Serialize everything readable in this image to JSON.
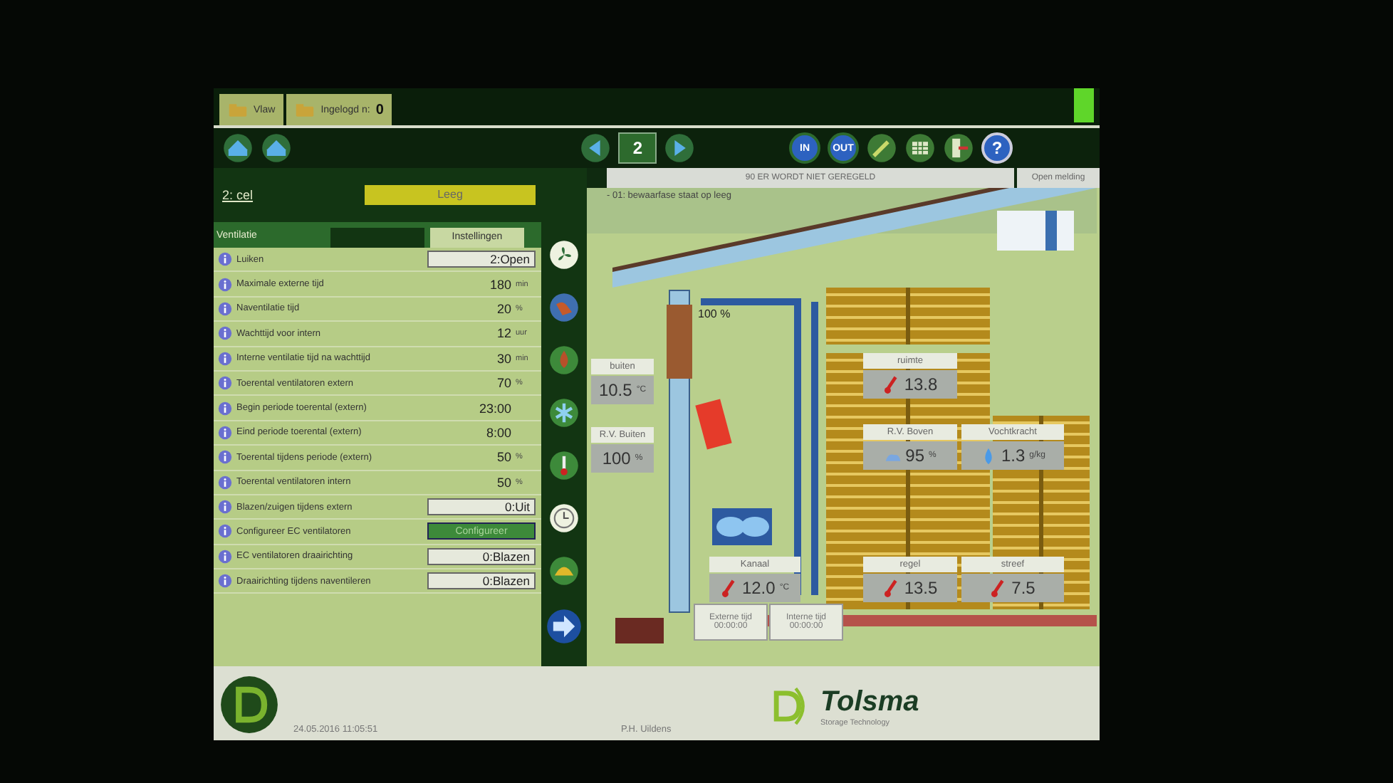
{
  "top_tabs": [
    {
      "label": "Vlaw"
    },
    {
      "label": "Ingelogd n:",
      "count": "0"
    }
  ],
  "nav": {
    "page": "2"
  },
  "toolbar": [
    {
      "kind": "in",
      "label": "IN"
    },
    {
      "kind": "out",
      "label": "OUT"
    },
    {
      "kind": "pencil"
    },
    {
      "kind": "grid"
    },
    {
      "kind": "exit"
    },
    {
      "kind": "help",
      "label": "?"
    }
  ],
  "cell": {
    "title": "2: cel",
    "phase": "Leeg"
  },
  "section": "Ventilatie",
  "tabs": [
    {
      "selected": false
    },
    {
      "label": "Instellingen",
      "selected": true
    }
  ],
  "rows": [
    {
      "kind": "field",
      "label": "Luiken",
      "value": "2:Open"
    },
    {
      "kind": "value",
      "label": "Maximale externe tijd",
      "value": "180",
      "unit": "min"
    },
    {
      "kind": "value",
      "label": "Naventilatie tijd",
      "value": "20",
      "unit": "%"
    },
    {
      "kind": "value",
      "label": "Wachttijd voor intern",
      "value": "12",
      "unit": "uur"
    },
    {
      "kind": "value",
      "label": "Interne ventilatie tijd na wachttijd",
      "value": "30",
      "unit": "min"
    },
    {
      "kind": "value",
      "label": "Toerental ventilatoren extern",
      "value": "70",
      "unit": "%"
    },
    {
      "kind": "value",
      "label": "Begin periode toerental (extern)",
      "value": "23:00"
    },
    {
      "kind": "value",
      "label": "Eind periode toerental (extern)",
      "value": "8:00"
    },
    {
      "kind": "value",
      "label": "Toerental tijdens periode (extern)",
      "value": "50",
      "unit": "%"
    },
    {
      "kind": "value",
      "label": "Toerental ventilatoren intern",
      "value": "50",
      "unit": "%"
    },
    {
      "kind": "field",
      "label": "Blazen/zuigen tijdens extern",
      "value": "0:Uit"
    },
    {
      "kind": "button",
      "label": "Configureer EC ventilatoren",
      "value": "Configureer"
    },
    {
      "kind": "field",
      "label": "EC ventilatoren draairichting",
      "value": "0:Blazen"
    },
    {
      "kind": "field",
      "label": "Draairichting tijdens naventileren",
      "value": "0:Blazen"
    }
  ],
  "status": {
    "message": "90 ER WORDT NIET GEREGELD",
    "button": "Open melding",
    "alert": "- 01: bewaarfase staat op leeg"
  },
  "diagram": {
    "flap": "100 %"
  },
  "sensors": [
    {
      "kind": "plain",
      "label": "buiten",
      "value": "10.5",
      "unit": "°C"
    },
    {
      "kind": "plain",
      "label": "R.V. Buiten",
      "value": "100",
      "unit": "%"
    },
    {
      "kind": "temperature",
      "label": "ruimte",
      "value": "13.8"
    },
    {
      "kind": "humidity",
      "label": "R.V. Boven",
      "value": "95",
      "unit": "%"
    },
    {
      "kind": "moisture",
      "label": "Vochtkracht",
      "value": "1.3",
      "unit": "g/kg"
    },
    {
      "kind": "temperature",
      "label": "Kanaal",
      "value": "12.0",
      "unit": "°C"
    },
    {
      "kind": "temperature",
      "label": "regel",
      "value": "13.5"
    },
    {
      "kind": "temperature",
      "label": "streef",
      "value": "7.5"
    }
  ],
  "times": [
    {
      "label": "Externe tijd",
      "value": "00:00:00"
    },
    {
      "label": "Interne tijd",
      "value": "00:00:00"
    }
  ],
  "footer": {
    "datetime": "24.05.2016 11:05:51",
    "user": "P.H. Uildens",
    "brand": "Tolsma",
    "tagline": "Storage Technology"
  }
}
